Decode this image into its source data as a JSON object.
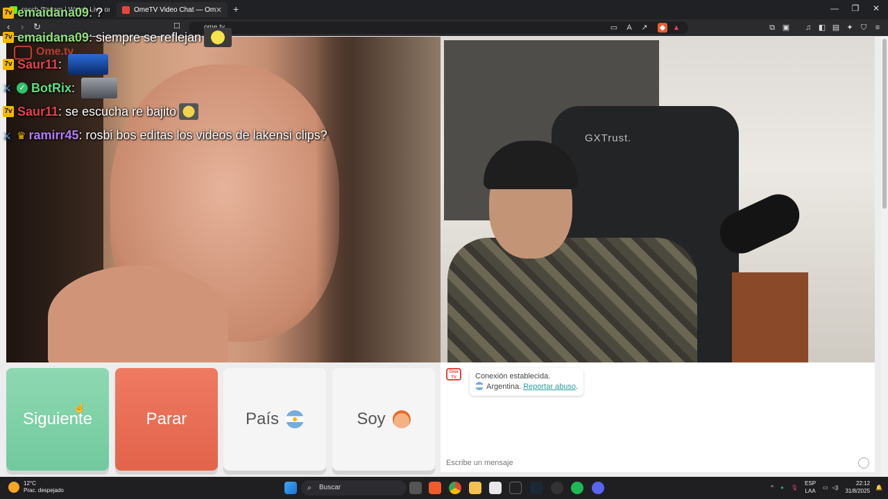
{
  "browser": {
    "tabs": [
      {
        "label": "rosch Stream | Watch Live on Kick",
        "active": false
      },
      {
        "label": "OmeTV Video Chat — Omegle",
        "active": true
      }
    ],
    "new_tab": "+",
    "url": "ome.tv",
    "window_controls": {
      "minimize": "—",
      "maximize": "❐",
      "close": "✕"
    }
  },
  "stream_chat": [
    {
      "badge": "kick-7tv",
      "user": "emaidana09",
      "user_color": "#8fe07a",
      "message": "?",
      "emote": false
    },
    {
      "badge": "kick-7tv",
      "user": "emaidana09",
      "user_color": "#8fe07a",
      "message": "siempre se reflejan",
      "emote": true
    },
    {
      "badge": "kick-7tv",
      "user": "Saur11",
      "user_color": "#e0434b",
      "message": "",
      "emote": true
    },
    {
      "badge": "sword-check",
      "user": "BotRix",
      "user_color": "#5be07a",
      "message": "",
      "emote": true
    },
    {
      "badge": "kick-7tv",
      "user": "Saur11",
      "user_color": "#e0434b",
      "message": "se escucha re bajito",
      "emote": true
    },
    {
      "badge": "sword-crown",
      "user": "ramirr45",
      "user_color": "#b37cf2",
      "message": "rosbi bos editas los videos de lakensi clips?",
      "emote": false
    }
  ],
  "overlay_watermark": "Ome.tv",
  "remote_video": {
    "brand_on_chair": "GXTrust."
  },
  "controls": {
    "next": "Siguiente",
    "stop": "Parar",
    "country": "País",
    "gender": "Soy"
  },
  "chat": {
    "logo": "Ome TV",
    "status": "Conexión establecida.",
    "country": "Argentina.",
    "report_link": "Reportar abuso",
    "input_placeholder": "Escribe un mensaje"
  },
  "taskbar": {
    "weather_temp": "12°C",
    "weather_desc": "Prac. despejado",
    "search_placeholder": "Buscar",
    "lang": "ESP",
    "lang_sub": "LAA",
    "time": "22:12",
    "date": "31/8/2025"
  },
  "colors": {
    "next_green": "#7ccfa6",
    "stop_red": "#e86a52",
    "accent_teal": "#2b9c9c"
  }
}
